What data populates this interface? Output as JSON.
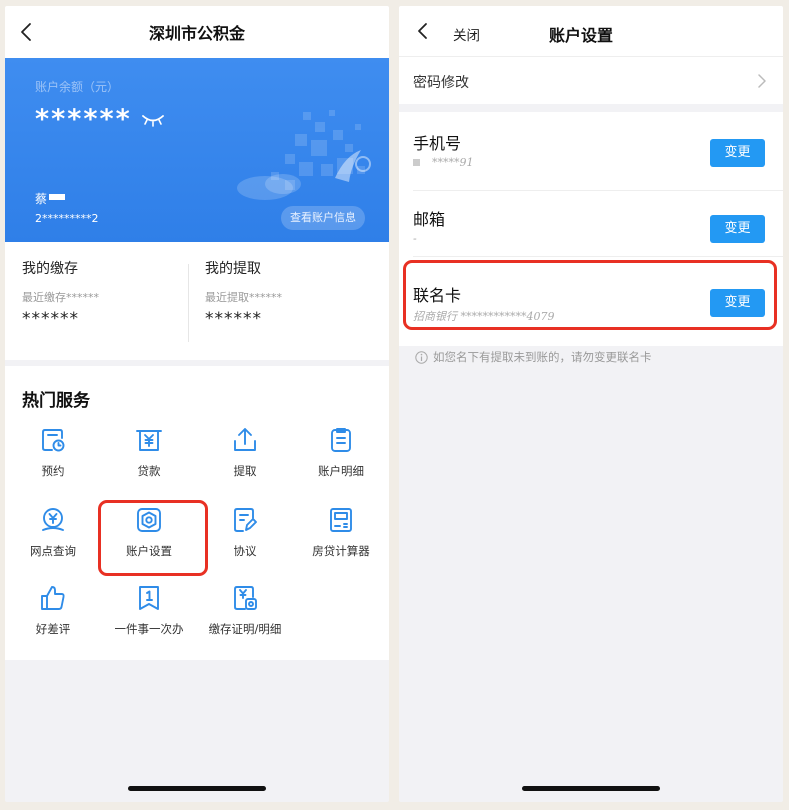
{
  "left": {
    "nav": {
      "title": "深圳市公积金"
    },
    "banner": {
      "balance_label": "账户余额（元）",
      "balance_value": "******",
      "name_prefix": "蔡",
      "account_number": "2*********2",
      "view_info_button": "查看账户信息"
    },
    "summary": {
      "deposit": {
        "title": "我的缴存",
        "sub": "最近缴存******",
        "value": "******"
      },
      "withdraw": {
        "title": "我的提取",
        "sub": "最近提取******",
        "value": "******"
      }
    },
    "services": {
      "title": "热门服务",
      "items": [
        {
          "label": "预约",
          "icon": "calendar-clock-icon"
        },
        {
          "label": "贷款",
          "icon": "yuan-receipt-icon"
        },
        {
          "label": "提取",
          "icon": "upload-icon"
        },
        {
          "label": "账户明细",
          "icon": "clipboard-icon"
        },
        {
          "label": "网点查询",
          "icon": "location-yuan-icon"
        },
        {
          "label": "账户设置",
          "icon": "hexagon-settings-icon"
        },
        {
          "label": "协议",
          "icon": "document-edit-icon"
        },
        {
          "label": "房贷计算器",
          "icon": "calculator-icon"
        },
        {
          "label": "好差评",
          "icon": "thumbs-up-icon"
        },
        {
          "label": "一件事一次办",
          "icon": "bookmark-one-icon"
        },
        {
          "label": "缴存证明/明细",
          "icon": "certificate-icon"
        }
      ]
    }
  },
  "right": {
    "nav": {
      "close": "关闭",
      "title": "账户设置"
    },
    "password_row": {
      "label": "密码修改"
    },
    "phone": {
      "title": "手机号",
      "value": "*****91",
      "button": "变更"
    },
    "email": {
      "title": "邮箱",
      "value": "-",
      "button": "变更"
    },
    "card": {
      "title": "联名卡",
      "value": "招商银行 ************4079",
      "button": "变更"
    },
    "notice": "如您名下有提取未到账的，请勿变更联名卡"
  },
  "colors": {
    "banner_blue": "#3a88ee",
    "icon_blue": "#2f8ce8",
    "button_blue": "#2399f3",
    "highlight_red": "#e83023"
  }
}
